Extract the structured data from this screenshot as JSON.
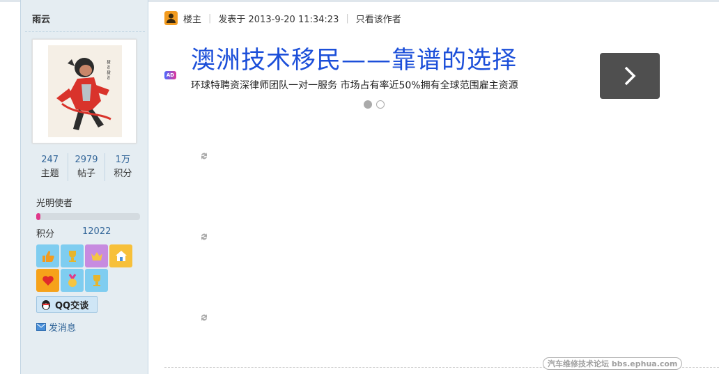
{
  "user": {
    "name": "雨云",
    "stats": [
      {
        "value": "247",
        "label": "主题"
      },
      {
        "value": "2979",
        "label": "帖子"
      },
      {
        "value": "1万",
        "label": "积分"
      }
    ],
    "rank_title": "光明使者",
    "rank_progress_percent": 4,
    "points_label": "积分",
    "points_value": "12022",
    "medals": [
      "thumbs-up-medal-icon",
      "trophy-medal-icon",
      "crown-medal-icon",
      "house-medal-icon",
      "heart-medal-icon",
      "gold-medal-icon",
      "trophy-medal-icon"
    ],
    "qq_label": "QQ交谈",
    "send_message_label": "发消息"
  },
  "post": {
    "owner_label": "楼主",
    "posted_at": "发表于 2013-9-20 11:34:23",
    "only_author_label": "只看该作者"
  },
  "ad": {
    "badge": "AD",
    "title": "澳洲技术移民——靠谱的选择",
    "description": "环球特聘资深律师团队一对一服务 市场占有率近50%拥有全球范围雇主资源",
    "slides_total": 2,
    "slide_active": 1
  },
  "watermark": "汽车维修技术论坛 bbs.ephua.com",
  "colors": {
    "sidebar_bg": "#e5edf2",
    "link_blue": "#336699",
    "ad_title_blue": "#1c4fd9",
    "rank_fill": "#e0388a"
  }
}
